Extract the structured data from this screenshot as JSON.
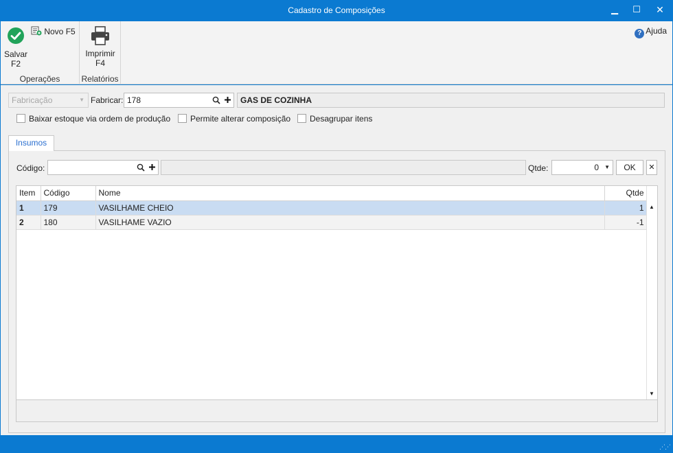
{
  "window": {
    "title": "Cadastro de Composições",
    "min_glyph": "▁",
    "max_glyph": "☐",
    "close_glyph": "✕"
  },
  "ribbon": {
    "salvar_label": "Salvar",
    "salvar_key": "F2",
    "novo_label": "Novo F5",
    "operacoes_label": "Operações",
    "imprimir_label": "Imprimir",
    "imprimir_key": "F4",
    "relatorios_label": "Relatórios",
    "help_label": "Ajuda"
  },
  "form": {
    "tipo_value": "Fabricação",
    "fabricar_label": "Fabricar:",
    "fabricar_value": "178",
    "produto_nome": "GAS DE COZINHA",
    "checks": [
      {
        "label": "Baixar estoque via ordem de produção",
        "checked": false
      },
      {
        "label": "Permite alterar composição",
        "checked": false
      },
      {
        "label": "Desagrupar itens",
        "checked": false
      }
    ]
  },
  "tab": {
    "label": "Insumos"
  },
  "insumos": {
    "codigo_label": "Código:",
    "codigo_value": "",
    "descricao_value": "",
    "qtde_label": "Qtde:",
    "qtde_value": "0",
    "ok_label": "OK",
    "clear_glyph": "✕"
  },
  "grid": {
    "columns": [
      "Item",
      "Código",
      "Nome",
      "Qtde"
    ],
    "rows": [
      {
        "item": "1",
        "codigo": "179",
        "nome": "VASILHAME CHEIO",
        "qtde": "1"
      },
      {
        "item": "2",
        "codigo": "180",
        "nome": "VASILHAME VAZIO",
        "qtde": "-1"
      }
    ]
  },
  "icons": {
    "save": "check-circle-icon",
    "new": "new-document-icon",
    "print": "printer-icon",
    "help": "help-icon",
    "search": "search-icon",
    "add": "plus-icon",
    "dropdown": "chevron-down-icon"
  },
  "colors": {
    "titlebar": "#0b7ad1",
    "save_green": "#21a35a",
    "selected_row": "#c9dcf2",
    "tab_text": "#2a6fd0"
  }
}
